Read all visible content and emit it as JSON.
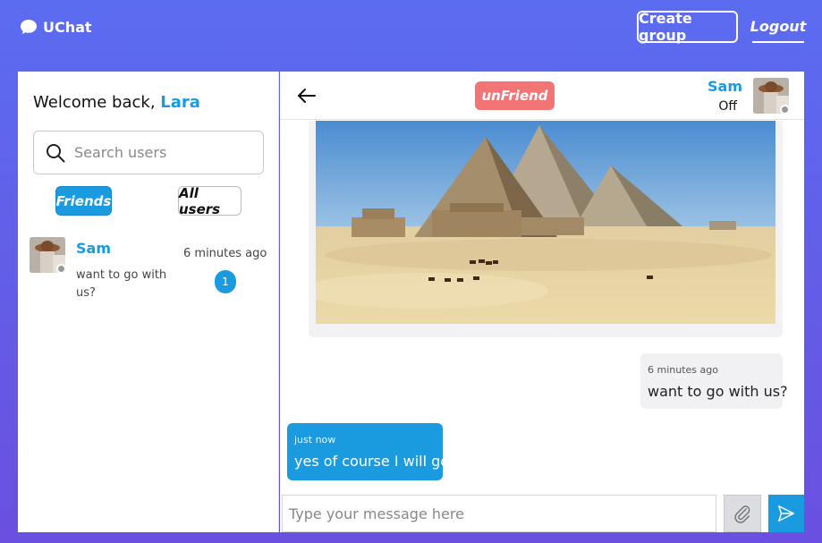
{
  "app": {
    "brand_name": "UChat",
    "brand_icon": "chat-bubble-icon"
  },
  "topbar": {
    "create_group_label": "Create group",
    "logout_label": "Logout"
  },
  "sidebar": {
    "welcome_prefix": "Welcome back, ",
    "current_user": "Lara",
    "search_placeholder": "Search users",
    "tabs": [
      {
        "label": "Friends",
        "active": true
      },
      {
        "label": "All users",
        "active": false
      }
    ],
    "conversations": [
      {
        "name": "Sam",
        "last_message": "want to go with us?",
        "time": "6 minutes ago",
        "unread": "1",
        "online": false
      }
    ]
  },
  "chat": {
    "unfriend_label": "unFriend",
    "contact_name": "Sam",
    "contact_status": "Off",
    "messages": [
      {
        "type": "image",
        "direction": "incoming",
        "alt": "pyramids photo"
      },
      {
        "type": "text",
        "direction": "incoming",
        "time": "6 minutes ago",
        "text": "want to go with us?"
      },
      {
        "type": "text",
        "direction": "outgoing",
        "time": "just now",
        "text": "yes of course I will go"
      }
    ],
    "composer_placeholder": "Type your message here"
  },
  "colors": {
    "accent": "#1a9be0",
    "danger": "#f27474",
    "background_top": "#5b6cf0",
    "background_bottom": "#6a4fe0"
  }
}
